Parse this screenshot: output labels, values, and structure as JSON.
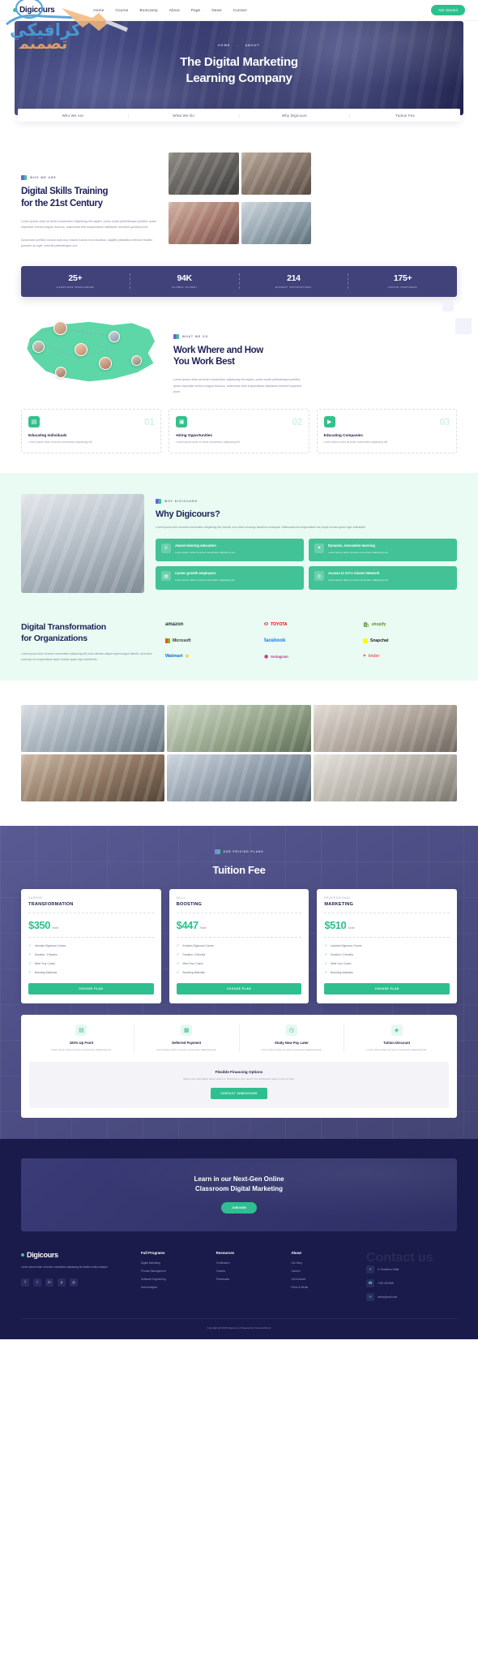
{
  "brand": {
    "name": "Digicours",
    "accent": "#2fbf8f",
    "dark": "#1f2257",
    "purple": "#41427a"
  },
  "header": {
    "nav": [
      {
        "label": "Home"
      },
      {
        "label": "Course"
      },
      {
        "label": "Bootcamp"
      },
      {
        "label": "About"
      },
      {
        "label": "Page"
      },
      {
        "label": "News"
      },
      {
        "label": "Contact"
      }
    ],
    "cta_label": "Get Started"
  },
  "watermark": {
    "line1": "كرافيكي",
    "line2": "تصميم"
  },
  "hero": {
    "breadcrumb": [
      "HOME",
      "-",
      "ABOUT"
    ],
    "title_line1": "The Digital Marketing",
    "title_line2": "Learning Company"
  },
  "tabs": [
    {
      "label": "Who We Are"
    },
    {
      "label": "What We Do"
    },
    {
      "label": "Why Digicours"
    },
    {
      "label": "Tuition Fee"
    }
  ],
  "who_we_are": {
    "eyebrow": "WHO WE ARE",
    "title_line1": "Digital Skills Training",
    "title_line2": "for the 21st Century",
    "para1": "Lorem ipsum dolor sit amet consectetur adipiscing elit sapien, purus sociis pellentesque porttitor quam imperdiet viverra magna rhoncus, maecenas felis suspendisse habitasse hendrerit gravida proin.",
    "para2": "Accumsan porttitor cursus duis arcu mauris luctus nunc faucibus, sagittis phasellus interdum facilisi posuere ac eget, lobortis pellentesque orci."
  },
  "stats": [
    {
      "num": "25+",
      "label": "CAMPUSES WORLDWIDE"
    },
    {
      "num": "94K",
      "label": "GLOBAL ALUMNI"
    },
    {
      "num": "214",
      "label": "EXPERT INSTRUCTORS"
    },
    {
      "num": "175+",
      "label": "HIRING PARTNERS"
    }
  ],
  "what_we_do": {
    "eyebrow": "WHAT WE DO",
    "title_line1": "Work Where and How",
    "title_line2": "You Work Best",
    "para": "Lorem ipsum dolor sit amet consectetur adipiscing elit sapien, purus sociis pellentesque porttitor quam imperdiet viverra magna rhoncus, maecenas felis suspendisse habitasse hendrerit gravida proin.",
    "cards": [
      {
        "num": "01",
        "icon": "book-icon",
        "title": "Educating Individuals",
        "desc": "Lorem ipsum dolor sit amet consectetur adipiscing elit."
      },
      {
        "num": "02",
        "icon": "laptop-icon",
        "title": "Hiring Opportunities",
        "desc": "Lorem ipsum dolor sit amet consectetur adipiscing elit."
      },
      {
        "num": "03",
        "icon": "video-icon",
        "title": "Educating Companies",
        "desc": "Lorem ipsum dolor sit amet consectetur adipiscing elit."
      }
    ]
  },
  "why": {
    "eyebrow": "WHY DIGICOURS",
    "title": "Why Digicours?",
    "para": "Lorem ipsum dolor sit amet consectetur adipiscing elit, blandit, urna diam sociosqu faucibus consequat. Malesuada est suspendisse hac turpis montes quam eget sollicitudin",
    "features": [
      {
        "icon": "trophy-icon",
        "title": "Award-winning education",
        "desc": "Lorem ipsum dolor sit amet consectetur adipiscing elit."
      },
      {
        "icon": "rocket-icon",
        "title": "Dynamic, innovative learning",
        "desc": "Lorem ipsum dolor sit amet consectetur adipiscing elit."
      },
      {
        "icon": "chart-icon",
        "title": "Career growth employers",
        "desc": "Lorem ipsum dolor sit amet consectetur adipiscing elit."
      },
      {
        "icon": "network-icon",
        "title": "Access to GA's Alumni Network",
        "desc": "Lorem ipsum dolor sit amet consectetur adipiscing elit."
      }
    ]
  },
  "brands": {
    "title_line1": "Digital Transformation",
    "title_line2": "for Organizations",
    "para": "Lorem ipsum dolor sit amet consectetur adipiscing elit, indio ultricies aliquet aptent augue blandit, urna diam sociosqu est suspendisse turpis montes quam eget sollicitudin.",
    "logos": [
      {
        "name": "amazon"
      },
      {
        "name": "TOYOTA"
      },
      {
        "name": "shopify"
      },
      {
        "name": "Microsoft"
      },
      {
        "name": "facebook"
      },
      {
        "name": "Snapchat"
      },
      {
        "name": "Walmart"
      },
      {
        "name": "Instagram"
      },
      {
        "name": "tinder"
      }
    ]
  },
  "tuition": {
    "eyebrow": "OUR PRICING PLANS",
    "title": "Tuition Fee",
    "plans": [
      {
        "category": "CAREER",
        "name": "TRANSFORMATION",
        "price": "$350",
        "per": "/ Month",
        "features": [
          "Includes Digicours Course",
          "Duration: 3 Months",
          "Meet Your Coach",
          "Branding Materials"
        ],
        "button": "CHOOSE PLAN"
      },
      {
        "category": "SKILL",
        "name": "BOOSTING",
        "price": "$447",
        "per": "/ Month",
        "features": [
          "Includes Digicours Course",
          "Duration: 3 Months",
          "Meet Your Coach",
          "Branding Materials"
        ],
        "button": "CHOOSE PLAN"
      },
      {
        "category": "PROFESSIONAL",
        "name": "MARKETING",
        "price": "$510",
        "per": "/ Month",
        "features": [
          "Includes Digicours Course",
          "Duration: 3 Months",
          "Meet Your Coach",
          "Branding Materials"
        ],
        "button": "CHOOSE PLAN"
      }
    ],
    "financing": [
      {
        "icon": "wallet-icon",
        "title": "100% Up Front",
        "desc": "Lorem ipsum dolor sit amet consectetur adipiscing elit."
      },
      {
        "icon": "calendar-icon",
        "title": "Deferred Payment",
        "desc": "Lorem ipsum dolor sit amet consectetur adipiscing elit."
      },
      {
        "icon": "clock-icon",
        "title": "Study Now Pay Later",
        "desc": "Lorem ipsum dolor sit amet consectetur adipiscing elit."
      },
      {
        "icon": "tag-icon",
        "title": "Tuition Discount",
        "desc": "Lorem ipsum dolor sit amet consectetur adipiscing elit."
      }
    ],
    "banner": {
      "title": "Flexible Financing Options",
      "desc": "Want more information about orders or financing or your need? Our Admissions team is here to help.",
      "button": "CONTACT ADMISSIONS"
    }
  },
  "footer": {
    "cta_line1": "Learn in our Next-Gen Online",
    "cta_line2": "Classroom Digital Marketing",
    "cta_button": "JOIN NOW",
    "brand_name": "Digicours",
    "brand_desc": "Lorem ipsum dolor sit amet consectetur adipiscing elit facilisi mollis natoque",
    "social": [
      {
        "icon": "facebook-icon",
        "glyph": "f"
      },
      {
        "icon": "twitter-icon",
        "glyph": "t"
      },
      {
        "icon": "linkedin-icon",
        "glyph": "in"
      },
      {
        "icon": "pinterest-icon",
        "glyph": "p"
      },
      {
        "icon": "instagram-icon",
        "glyph": "◎"
      }
    ],
    "columns": [
      {
        "heading": "Full Programs",
        "links": [
          "Digital Marketing",
          "Product Management",
          "Software Engineering",
          "Data Analytics"
        ]
      },
      {
        "heading": "Resources",
        "links": [
          "Certification",
          "Careers",
          "Teammates"
        ]
      },
      {
        "heading": "About",
        "links": [
          "Our Story",
          "Careers",
          "Get Involved",
          "Press & Media"
        ]
      }
    ],
    "contact_heading": "Contact us",
    "contacts": [
      {
        "icon": "location-icon",
        "text": "Jl. Soekarno Hatta"
      },
      {
        "icon": "phone-icon",
        "text": "+150 333 888"
      },
      {
        "icon": "mail-icon",
        "text": "hellos@mail.com"
      }
    ],
    "copyright": "Copyright @ 2023 Digicours | Powered by Onecontributor"
  }
}
